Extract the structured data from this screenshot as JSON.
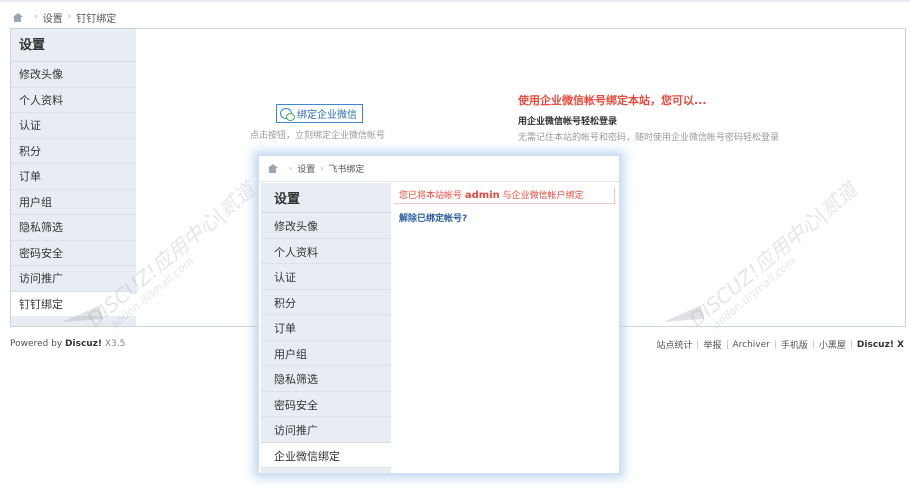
{
  "breadcrumb": {
    "home_icon": "home-icon",
    "items": [
      "设置",
      "钉钉绑定"
    ]
  },
  "sidebar": {
    "title": "设置",
    "items": [
      {
        "label": "修改头像"
      },
      {
        "label": "个人资料"
      },
      {
        "label": "认证"
      },
      {
        "label": "积分"
      },
      {
        "label": "订单"
      },
      {
        "label": "用户组"
      },
      {
        "label": "隐私筛选"
      },
      {
        "label": "密码安全"
      },
      {
        "label": "访问推广"
      },
      {
        "label": "钉钉绑定",
        "active": true
      }
    ]
  },
  "bind": {
    "button_label": "绑定企业微信",
    "hint": "点击按钮，立刻绑定企业微信帐号"
  },
  "info": {
    "title": "使用企业微信帐号绑定本站，您可以...",
    "subtitle": "用企业微信帐号轻松登录",
    "desc": "无需记住本站的帐号和密码，随时使用企业微信帐号密码轻松登录"
  },
  "footer": {
    "powered_prefix": "Powered by ",
    "powered_brand": "Discuz!",
    "version": " X3.5",
    "links": [
      "站点统计",
      "举报",
      "Archiver",
      "手机版",
      "小黑屋"
    ],
    "brand": "Discuz! X"
  },
  "watermark": {
    "text": "DISCUZ!应用中心|贰道",
    "sub": "addon.dismall.com"
  },
  "popup": {
    "breadcrumb": [
      "设置",
      "飞书绑定"
    ],
    "sidebar_title": "设置",
    "items": [
      {
        "label": "修改头像"
      },
      {
        "label": "个人资料"
      },
      {
        "label": "认证"
      },
      {
        "label": "积分"
      },
      {
        "label": "订单"
      },
      {
        "label": "用户组"
      },
      {
        "label": "隐私筛选"
      },
      {
        "label": "密码安全"
      },
      {
        "label": "访问推广"
      },
      {
        "label": "企业微信绑定",
        "active": true
      }
    ],
    "notice_prefix": "您已将本站帐号 ",
    "notice_user": "admin",
    "notice_suffix": " 与企业微信帐户绑定",
    "unbind_label": "解除已绑定帐号?"
  }
}
